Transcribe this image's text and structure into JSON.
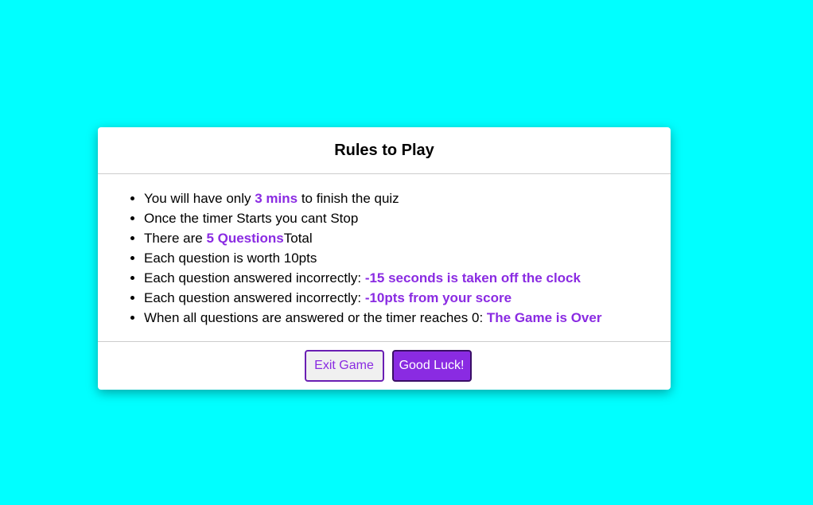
{
  "colors": {
    "page_background": "#00ffff",
    "accent": "#8a2be2",
    "primary_button": "#8a2be2"
  },
  "dialog": {
    "title": "Rules to Play",
    "rules": [
      {
        "pre": "You will have only ",
        "highlight": "3 mins",
        "post": " to finish the quiz"
      },
      {
        "pre": "Once the timer Starts you cant Stop",
        "highlight": "",
        "post": ""
      },
      {
        "pre": "There are ",
        "highlight": "5 Questions",
        "post": "Total"
      },
      {
        "pre": "Each question is worth 10pts",
        "highlight": "",
        "post": ""
      },
      {
        "pre": "Each question answered incorrectly: ",
        "highlight": "-15 seconds is taken off the clock",
        "post": ""
      },
      {
        "pre": "Each question answered incorrectly: ",
        "highlight": "-10pts from your score",
        "post": ""
      },
      {
        "pre": "When all questions are answered or the timer reaches 0: ",
        "highlight": "The Game is Over",
        "post": ""
      }
    ],
    "buttons": {
      "exit_label": "Exit Game",
      "start_label": "Good Luck!"
    }
  }
}
